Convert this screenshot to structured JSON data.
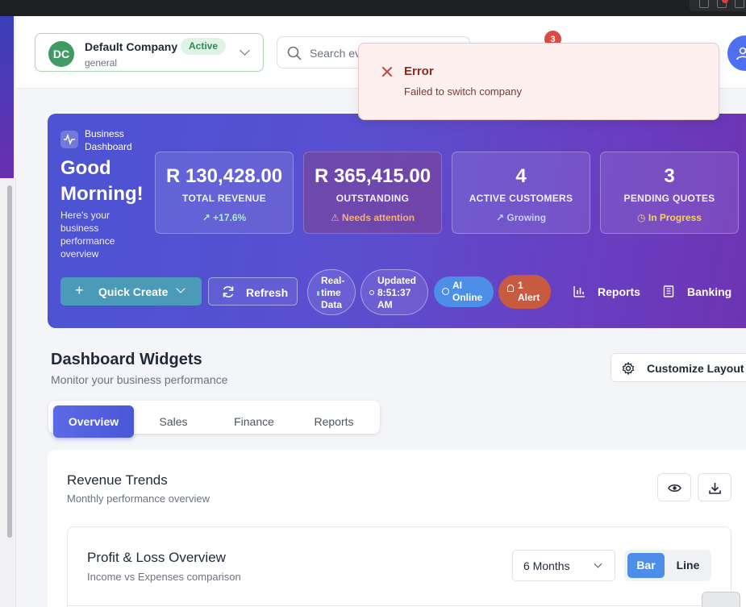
{
  "company": {
    "initials": "DC",
    "name": "Default Company",
    "status": "Active",
    "subtitle": "general"
  },
  "search": {
    "placeholder": "Search ev"
  },
  "notifications": {
    "count": "3"
  },
  "toast": {
    "title": "Error",
    "message": "Failed to switch company"
  },
  "hero": {
    "badge_label": "Business Dashboard",
    "greeting": "Good Morning!",
    "greeting_sub": "Here's your business performance overview",
    "stats": [
      {
        "value": "R 130,428.00",
        "label": "TOTAL REVENUE",
        "note": "↗ +17.6%"
      },
      {
        "value": "R 365,415.00",
        "label": "OUTSTANDING",
        "note": "⚠ Needs attention"
      },
      {
        "value": "4",
        "label": "ACTIVE CUSTOMERS",
        "note": "↗ Growing"
      },
      {
        "value": "3",
        "label": "PENDING QUOTES",
        "note": "◷ In Progress"
      }
    ],
    "quick_create": "Quick Create",
    "refresh": "Refresh",
    "realtime": "Real-time Data",
    "updated": "Updated 8:51:37 AM",
    "ai": "AI Online",
    "alert": "1 Alert",
    "reports": "Reports",
    "banking": "Banking"
  },
  "widgets": {
    "title": "Dashboard Widgets",
    "subtitle": "Monitor your business performance",
    "customize": "Customize Layout",
    "tabs": [
      "Overview",
      "Sales",
      "Finance",
      "Reports"
    ],
    "active_tab": "Overview"
  },
  "revenue": {
    "title": "Revenue Trends",
    "subtitle": "Monthly performance overview"
  },
  "profit_loss": {
    "title": "Profit & Loss Overview",
    "subtitle": "Income vs Expenses comparison",
    "period": "6 Months",
    "chart_types": [
      "Bar",
      "Line"
    ],
    "active_chart_type": "Bar"
  },
  "colors": {
    "accent": "#4a57d8",
    "success": "#3f9a63",
    "error": "#c0453c",
    "ai": "#4c8ee8",
    "alert": "#c85a3f"
  }
}
